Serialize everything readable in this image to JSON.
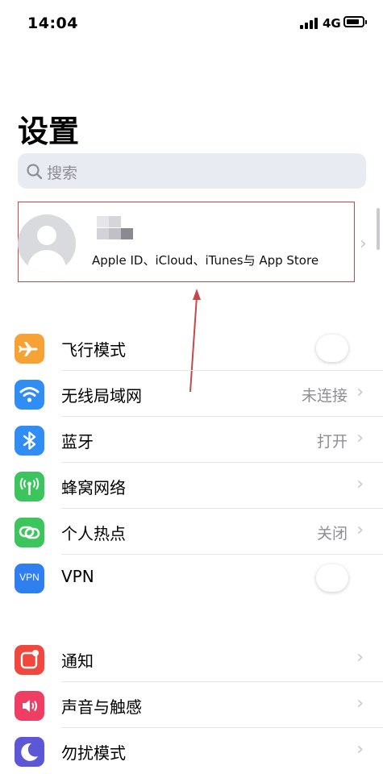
{
  "status_bar": {
    "time": "14:04",
    "network": "4G",
    "icons": [
      "signal-icon",
      "battery-icon"
    ]
  },
  "page": {
    "title": "设置",
    "search_placeholder": "搜索"
  },
  "profile": {
    "subtitle": "Apple ID、iCloud、iTunes与 App Store"
  },
  "settings_group_1": [
    {
      "id": "airplane",
      "label": "飞行模式",
      "value": "",
      "icon": "airplane-icon",
      "color": "#f7a234",
      "control": "toggle",
      "on": false
    },
    {
      "id": "wifi",
      "label": "无线局域网",
      "value": "未连接",
      "icon": "wifi-icon",
      "color": "#2f8df3",
      "control": "chevron"
    },
    {
      "id": "bluetooth",
      "label": "蓝牙",
      "value": "打开",
      "icon": "bluetooth-icon",
      "color": "#2f8df3",
      "control": "chevron"
    },
    {
      "id": "cellular",
      "label": "蜂窝网络",
      "value": "",
      "icon": "cellular-antenna-icon",
      "color": "#3bc55c",
      "control": "chevron"
    },
    {
      "id": "hotspot",
      "label": "个人热点",
      "value": "关闭",
      "icon": "hotspot-link-icon",
      "color": "#3bc55c",
      "control": "chevron"
    },
    {
      "id": "vpn",
      "label": "VPN",
      "value": "",
      "icon": "vpn-icon",
      "icon_text": "VPN",
      "color": "#2f7ff0",
      "control": "toggle",
      "on": false
    }
  ],
  "settings_group_2": [
    {
      "id": "notifications",
      "label": "通知",
      "icon": "notification-icon",
      "color": "#f0483e",
      "control": "chevron"
    },
    {
      "id": "sounds",
      "label": "声音与触感",
      "icon": "speaker-icon",
      "color": "#f03d63",
      "control": "chevron"
    },
    {
      "id": "dnd",
      "label": "勿扰模式",
      "icon": "moon-icon",
      "color": "#5b57d6",
      "control": "chevron"
    }
  ]
}
